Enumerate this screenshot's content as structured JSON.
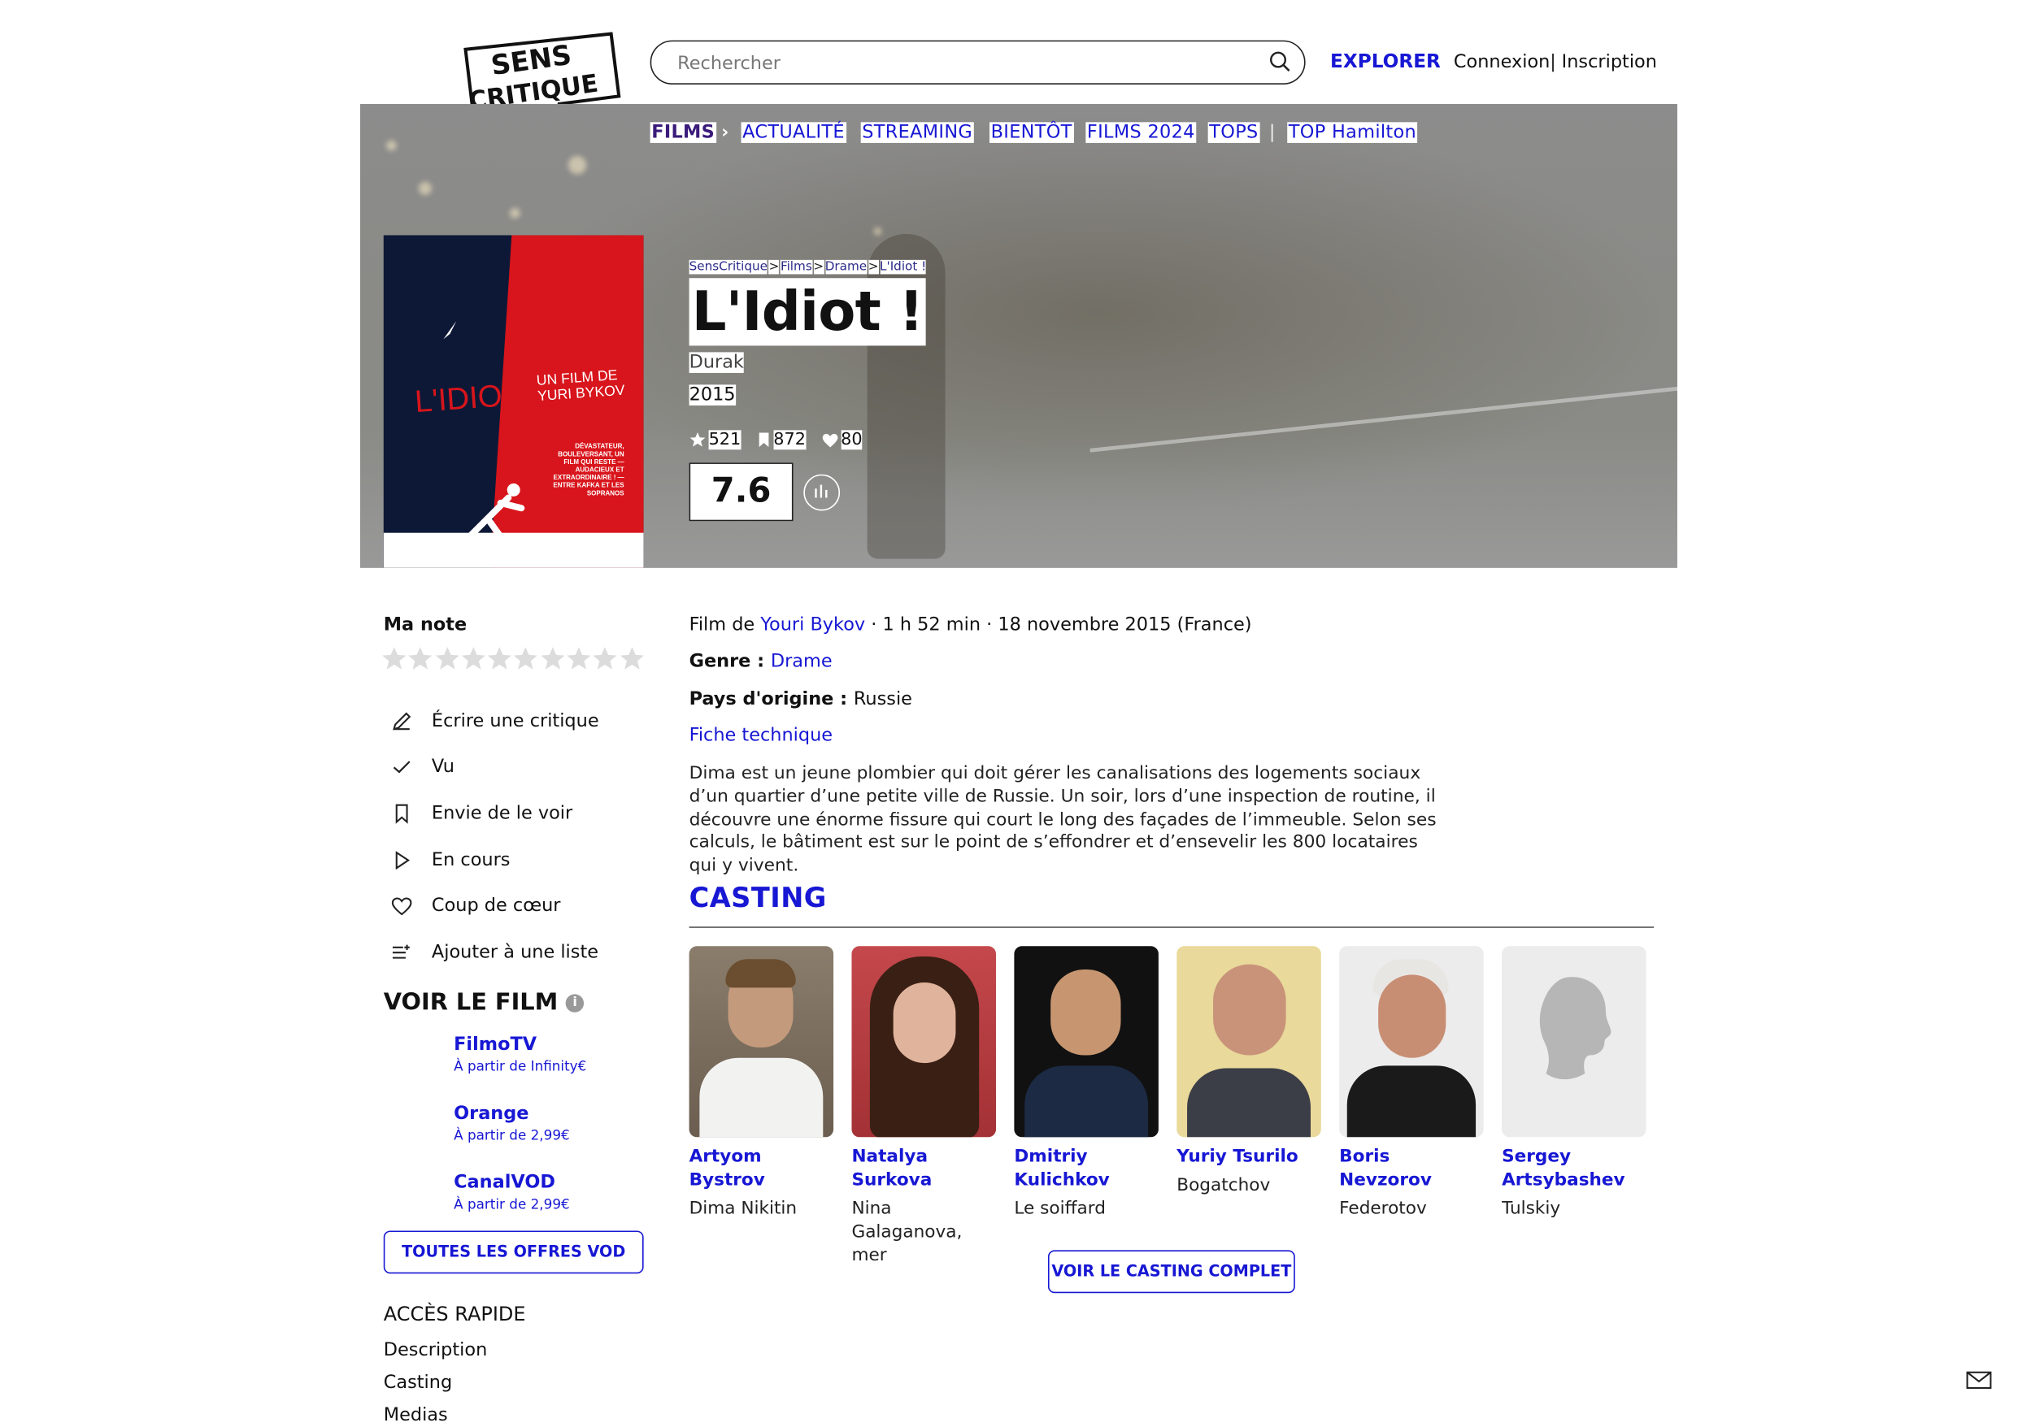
{
  "header": {
    "logo_line1": "SENS",
    "logo_line2": "CRITIQUE",
    "search_placeholder": "Rechercher",
    "explorer": "EXPLORER",
    "connexion": "Connexion",
    "separator": "|",
    "inscription": "Inscription"
  },
  "nav": {
    "films": "FILMS",
    "items": [
      "ACTUALITÉ",
      "STREAMING",
      "BIENTÔT",
      "FILMS 2024",
      "TOPS"
    ],
    "divider": "|",
    "top": "TOP Hamilton"
  },
  "breadcrumb": [
    "SensCritique",
    "Films",
    "Drame",
    "L'Idiot !"
  ],
  "movie": {
    "title": "L'Idiot !",
    "original_title": "Durak",
    "year": "2015",
    "stats": {
      "ratings": "521",
      "wishlist": "872",
      "favorites": "80"
    },
    "score": "7.6",
    "meta_prefix": "Film de ",
    "director": "Youri Bykov",
    "meta_suffix": " · 1 h 52 min · 18 novembre 2015 (France)",
    "genre_label": "Genre : ",
    "genre": "Drame",
    "country_label": "Pays d'origine : ",
    "country": "Russie",
    "fiche": "Fiche technique",
    "synopsis": "Dima est un jeune plombier qui doit gérer les canalisations des logements sociaux d’un quartier d’une petite ville de Russie. Un soir, lors d’une inspection de routine, il découvre une énorme fissure qui court le long des façades de l’immeuble. Selon ses calculs, le bâtiment est sur le point de s’effondrer et d’ensevelir les 800 locataires qui y vivent."
  },
  "poster": {
    "title": "L'IDIOT!",
    "subtitle_line1": "UN FILM DE",
    "subtitle_line2": "YURI BYKOV",
    "tagline": "DÉVASTATEUR, BOULEVERSANT, UN FILM QUI RESTE — AUDACIEUX ET EXTRAORDINAIRE ! — ENTRE KAFKA ET LES SOPRANOS"
  },
  "sidebar": {
    "ma_note": "Ma note",
    "star_count": 10,
    "actions": [
      {
        "label": "Écrire une critique",
        "icon": "pencil-icon"
      },
      {
        "label": "Vu",
        "icon": "check-icon"
      },
      {
        "label": "Envie de le voir",
        "icon": "bookmark-icon"
      },
      {
        "label": "En cours",
        "icon": "play-icon"
      },
      {
        "label": "Coup de cœur",
        "icon": "heart-icon"
      },
      {
        "label": "Ajouter à une liste",
        "icon": "list-add-icon"
      }
    ],
    "voir_le_film": "VOIR LE FILM",
    "vod": [
      {
        "name": "FilmoTV",
        "price": "À partir de Infinity€"
      },
      {
        "name": "Orange",
        "price": "À partir de 2,99€"
      },
      {
        "name": "CanalVOD",
        "price": "À partir de 2,99€"
      }
    ],
    "vod_button": "TOUTES LES OFFRES VOD",
    "acces_rapide": "ACCÈS RAPIDE",
    "quick_links": [
      "Description",
      "Casting",
      "Medias"
    ]
  },
  "casting": {
    "heading": "CASTING",
    "actors": [
      {
        "name": "Artyom Bystrov",
        "role": "Dima Nikitin"
      },
      {
        "name": "Natalya Surkova",
        "role": "Nina Galaganova, mer"
      },
      {
        "name": "Dmitriy Kulichkov",
        "role": "Le soiffard"
      },
      {
        "name": "Yuriy Tsurilo",
        "role": "Bogatchov"
      },
      {
        "name": "Boris Nevzorov",
        "role": "Federotov"
      },
      {
        "name": "Sergey Artsybashev",
        "role": "Tulskiy"
      }
    ],
    "button": "VOIR LE CASTING COMPLET"
  },
  "colors": {
    "accent": "#1717d4",
    "films_nav": "#3a1a7a",
    "poster_red": "#d8151c",
    "poster_navy": "#0d1836"
  }
}
